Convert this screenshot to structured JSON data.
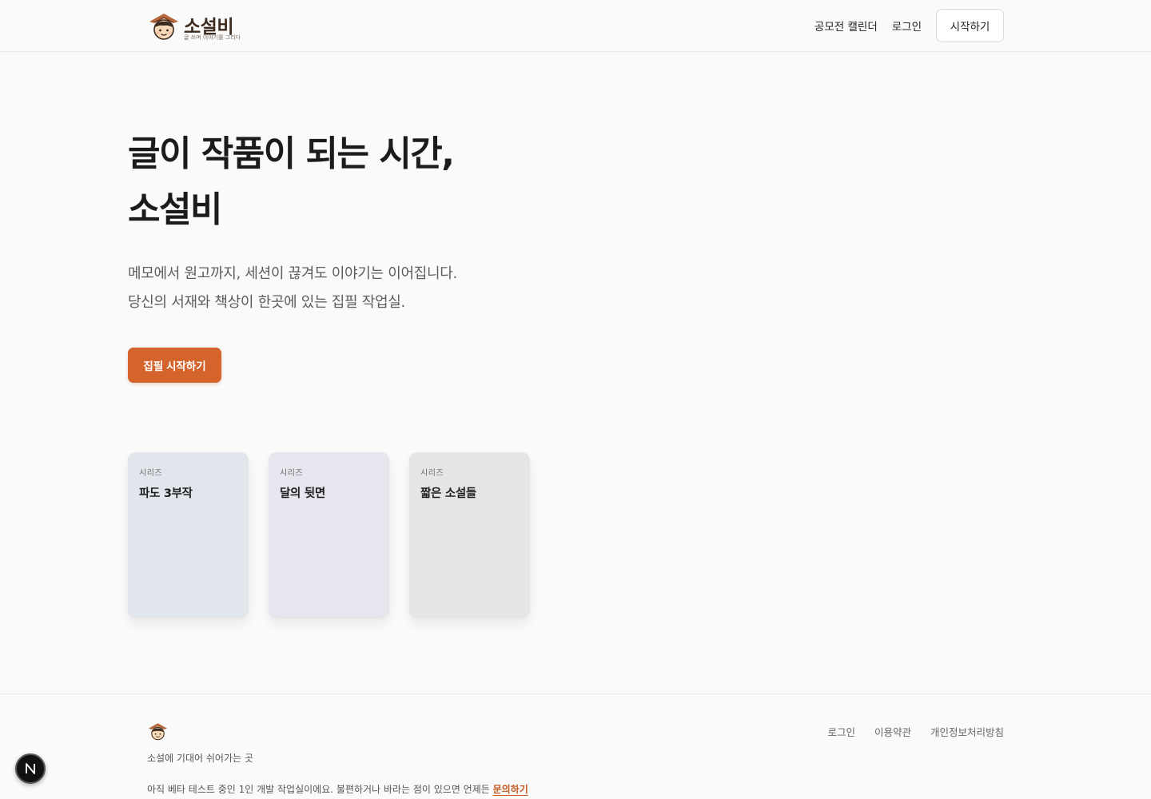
{
  "header": {
    "brand_name": "소설비",
    "brand_tagline": "글 쓰며 이야기를 그리다",
    "nav": [
      "공모전 캘린더",
      "로그인"
    ],
    "start_button": "시작하기"
  },
  "hero": {
    "title_lines": [
      "글이 작품이 되는 시간,",
      "소설비"
    ],
    "desc_lines": [
      "메모에서 원고까지, 세션이 끊겨도 이야기는 이어집니다.",
      "당신의 서재와 책상이 한곳에 있는 집필 작업실."
    ],
    "cta": "집필 시작하기",
    "accent": "#d4642c"
  },
  "series": [
    {
      "kicker": "시리즈",
      "title": "파도 3부작",
      "color": "#e1e6ec"
    },
    {
      "kicker": "시리즈",
      "title": "달의 뒷면",
      "color": "#e7e5ee"
    },
    {
      "kicker": "시리즈",
      "title": "짧은 소설들",
      "color": "#e3e6e4"
    }
  ],
  "footer": {
    "tagline": "소설에 기대어 쉬어가는 곳",
    "note": "아직 베타 테스트 중인 1인 개발 작업실이에요. 불편하거나 바라는 점이 있으면 언제든 ",
    "contact": "문의하기",
    "links": [
      "로그인",
      "이용약관",
      "개인정보처리방침"
    ]
  },
  "badge": {
    "letter": "N",
    "icon": "next-dev-icon"
  }
}
